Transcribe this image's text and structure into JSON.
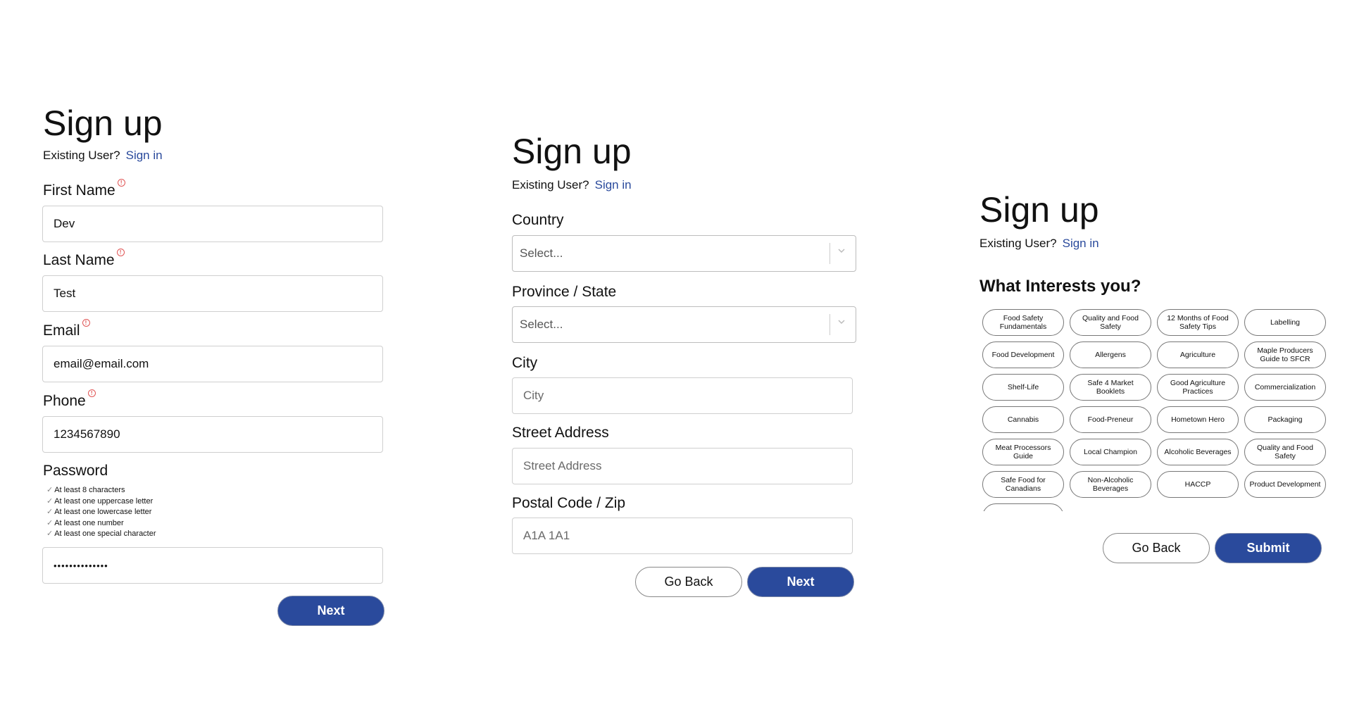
{
  "panel1": {
    "title": "Sign up",
    "existing_user": "Existing User?",
    "sign_in": "Sign in",
    "first_name": {
      "label": "First Name",
      "value": "Dev"
    },
    "last_name": {
      "label": "Last Name",
      "value": "Test"
    },
    "email": {
      "label": "Email",
      "value": "email@email.com"
    },
    "phone": {
      "label": "Phone",
      "value": "1234567890"
    },
    "password": {
      "label": "Password",
      "value": "••••••••••••••",
      "rules": [
        "At least 8 characters",
        "At least one uppercase letter",
        "At least one lowercase letter",
        "At least one number",
        "At least one special character"
      ]
    },
    "next": "Next"
  },
  "panel2": {
    "title": "Sign up",
    "existing_user": "Existing User?",
    "sign_in": "Sign in",
    "country": {
      "label": "Country",
      "placeholder": "Select..."
    },
    "province": {
      "label": "Province / State",
      "placeholder": "Select..."
    },
    "city": {
      "label": "City",
      "placeholder": "City"
    },
    "street": {
      "label": "Street Address",
      "placeholder": "Street Address"
    },
    "postal": {
      "label": "Postal Code / Zip",
      "placeholder": "A1A 1A1"
    },
    "go_back": "Go Back",
    "next": "Next"
  },
  "panel3": {
    "title": "Sign up",
    "existing_user": "Existing User?",
    "sign_in": "Sign in",
    "heading": "What Interests you?",
    "interests": [
      "Food Safety Fundamentals",
      "Quality and Food Safety",
      "12 Months of Food Safety Tips",
      "Labelling",
      "Food Development",
      "Allergens",
      "Agriculture",
      "Maple Producers Guide to SFCR",
      "Shelf-Life",
      "Safe 4 Market Booklets",
      "Good Agriculture Practices",
      "Commercialization",
      "Cannabis",
      "Food-Preneur",
      "Hometown Hero",
      "Packaging",
      "Meat Processors Guide",
      "Local Champion",
      "Alcoholic Beverages",
      "Quality and Food Safety",
      "Safe Food for Canadians",
      "Non-Alcoholic Beverages",
      "HACCP",
      "Product Development"
    ],
    "go_back": "Go Back",
    "submit": "Submit"
  },
  "colors": {
    "primary": "#2a4a9c",
    "required": "#e05555"
  },
  "icons": {
    "required": "alert-circle-icon",
    "select": "chevron-down-icon",
    "check": "check-icon"
  }
}
